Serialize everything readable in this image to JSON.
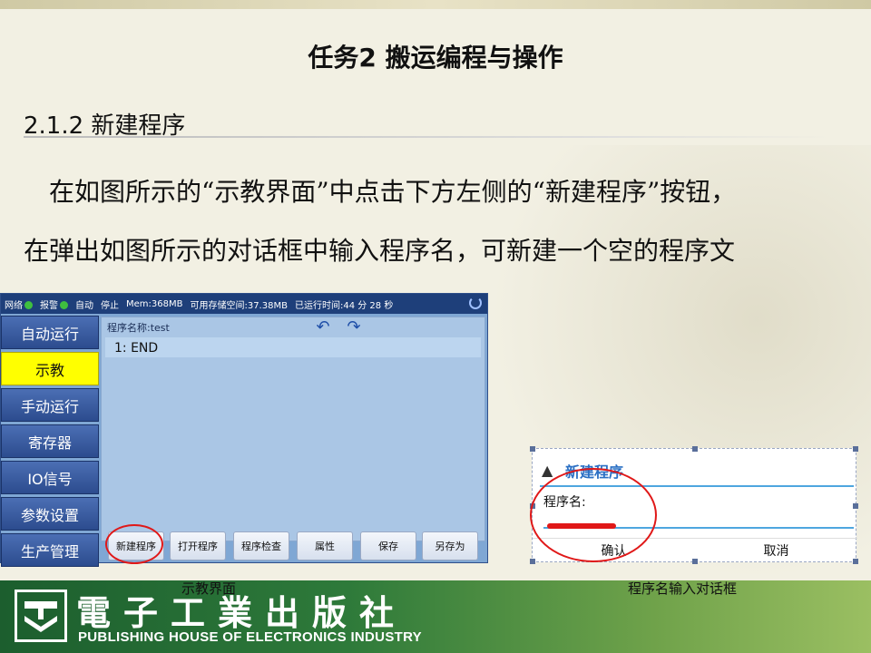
{
  "slide": {
    "title": "任务2  搬运编程与操作",
    "section": "2.1.2  新建程序",
    "paragraph_line1": "在如图所示的“示教界面”中点击下方左侧的“新建程序”按钮，",
    "paragraph_line2": "在弹出如图所示的对话框中输入程序名，可新建一个空的程序文"
  },
  "teach_ui": {
    "status": {
      "network": "网络",
      "alarm": "报警",
      "mode": "自动",
      "state": "停止",
      "mem": "Mem:368MB",
      "storage": "可用存储空间:37.38MB",
      "runtime": "已运行时间:44 分 28 秒"
    },
    "sidebar": [
      {
        "label": "自动运行"
      },
      {
        "label": "示教"
      },
      {
        "label": "手动运行"
      },
      {
        "label": "寄存器"
      },
      {
        "label": "IO信号"
      },
      {
        "label": "参数设置"
      },
      {
        "label": "生产管理"
      }
    ],
    "active_index": 1,
    "program_name": "程序名称:test",
    "code": [
      "1: END"
    ],
    "toolbar": [
      "新建程序",
      "打开程序",
      "程序检查",
      "属性",
      "保存",
      "另存为"
    ]
  },
  "dialog": {
    "title": "新建程序",
    "label": "程序名:",
    "confirm": "确认",
    "cancel": "取消"
  },
  "captions": {
    "teach": "示教界面",
    "dialog": "程序名输入对话框"
  },
  "footer": {
    "cn": "電子工業出版社",
    "en": "PUBLISHING HOUSE OF ELECTRONICS INDUSTRY"
  },
  "colors": {
    "highlight": "#ffff00",
    "annotation_red": "#e01818",
    "dialog_accent": "#4ea6df"
  }
}
